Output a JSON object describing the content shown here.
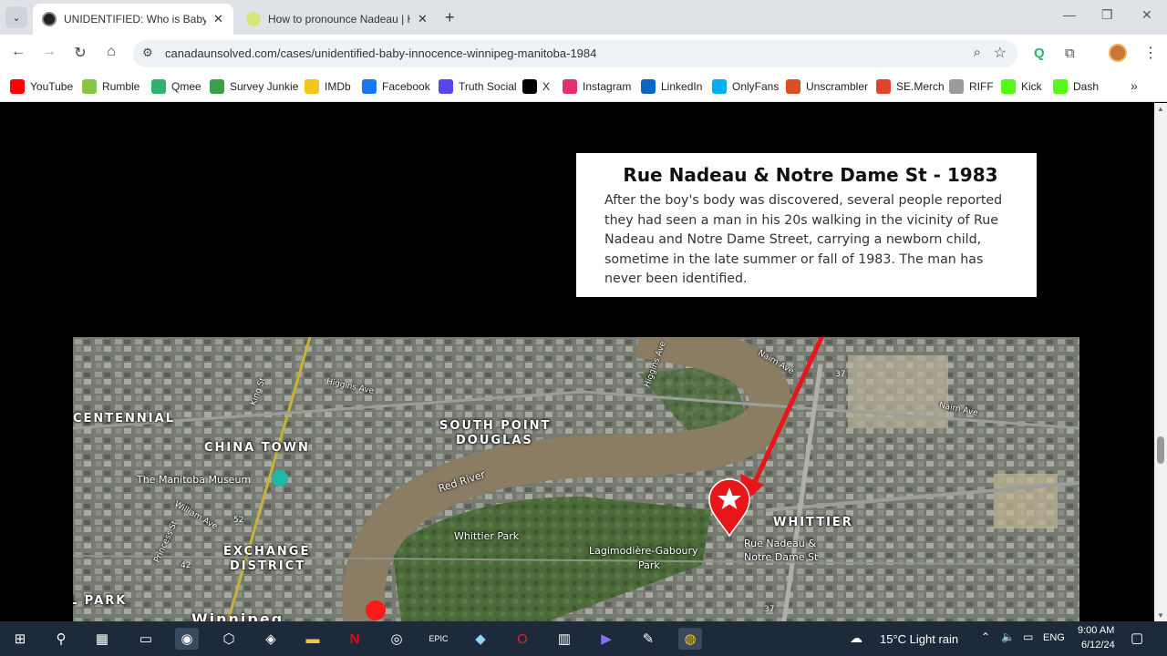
{
  "browser": {
    "tabs": [
      {
        "title": "UNIDENTIFIED: Who is Baby Innocence",
        "active": true
      },
      {
        "title": "How to pronounce Nadeau | How",
        "active": false
      }
    ],
    "url": "canadaunsolved.com/cases/unidentified-baby-innocence-winnipeg-manitoba-1984"
  },
  "bookmarks": [
    {
      "label": "YouTube",
      "icon": "youtube-icon",
      "color": "#ff0000"
    },
    {
      "label": "Rumble",
      "icon": "rumble-icon",
      "color": "#85c742"
    },
    {
      "label": "Qmee",
      "icon": "qmee-icon",
      "color": "#2fb36a"
    },
    {
      "label": "Survey Junkie",
      "icon": "survey-junkie-icon",
      "color": "#3aa04a"
    },
    {
      "label": "IMDb",
      "icon": "imdb-icon",
      "color": "#f5c518"
    },
    {
      "label": "Facebook",
      "icon": "facebook-icon",
      "color": "#1877f2"
    },
    {
      "label": "Truth Social",
      "icon": "truth-social-icon",
      "color": "#5448ee"
    },
    {
      "label": "X",
      "icon": "x-icon",
      "color": "#000000"
    },
    {
      "label": "Instagram",
      "icon": "instagram-icon",
      "color": "#e1306c"
    },
    {
      "label": "LinkedIn",
      "icon": "linkedin-icon",
      "color": "#0a66c2"
    },
    {
      "label": "OnlyFans",
      "icon": "onlyfans-icon",
      "color": "#00aff0"
    },
    {
      "label": "Unscrambler",
      "icon": "unscrambler-icon",
      "color": "#d9501e"
    },
    {
      "label": "SE.Merch",
      "icon": "se-merch-icon",
      "color": "#e0442b"
    },
    {
      "label": "RIFF",
      "icon": "riff-icon",
      "color": "#9a9a9a"
    },
    {
      "label": "Kick",
      "icon": "kick-icon",
      "color": "#53fc18"
    },
    {
      "label": "Dash",
      "icon": "dash-icon",
      "color": "#53fc18"
    }
  ],
  "callout": {
    "title": "Rue Nadeau & Notre Dame St - 1983",
    "lines": [
      "After the boy's body was discovered, several people reported",
      "they had seen a man in his 20s walking in the vicinity of Rue",
      "Nadeau and Notre Dame Street, carrying a newborn child,",
      "sometime in the late summer or fall of 1983. The man has",
      "never been identified."
    ]
  },
  "map": {
    "labels": {
      "centennial": "CENTENNIAL",
      "chinatown": "CHINA TOWN",
      "museum": "The Manitoba Museum",
      "exchange1": "EXCHANGE",
      "exchange2": "DISTRICT",
      "south1": "SOUTH POINT",
      "south2": "DOUGLAS",
      "redriver": "Red River",
      "whittierpark": "Whittier Park",
      "lagi1": "Lagimodière-Gaboury",
      "lagi2": "Park",
      "whittier": "WHITTIER",
      "pin1": "Rue Nadeau &",
      "pin2": "Notre Dame St",
      "higgins": "Higgins Ave",
      "higgins2": "Higgins Ave",
      "nairn": "Nairn Ave",
      "nairn2": "Nairn Ave",
      "king": "King St",
      "william": "William Ave",
      "princess": "Princess St",
      "park": "L PARK",
      "winnipeg": "Winnipeg",
      "hwy52": "52",
      "hwy42": "42",
      "hwy37": "37",
      "hwy37b": "37"
    },
    "colors": {
      "arrow": "#e8161b",
      "pin": "#e8161b",
      "river": "#8a7d64"
    }
  },
  "taskbar": {
    "weather": "15°C  Light rain",
    "lang": "ENG",
    "time": "9:00 AM",
    "date": "6/12/24"
  }
}
